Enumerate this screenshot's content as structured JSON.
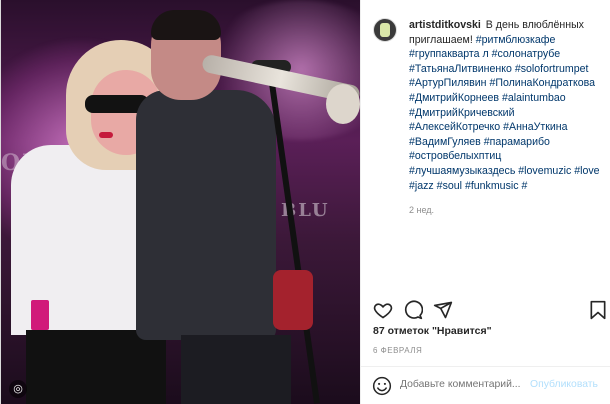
{
  "post": {
    "username": "artistditkovski",
    "caption_text": "В день влюблённых приглашаем!",
    "hashtags": "#ритмблюзкафе #группакварта л #солонатрубе #ТатьянаЛитвиненко #solofortrumpet #АртурПилявин #ПолинаКондраткова #ДмитрийКорнеев #alaintumbao #ДмитрийКричевский #АлексейКотречко #АннаУткина #ВадимГуляев #парамарибо #островбелыхптиц #лучшаямузыказдесь #lovemuzic #love #jazz #soul #funkmusic #",
    "time_ago": "2 нед.",
    "likes": "87 отметок \"Нравится\"",
    "date": "6 ФЕВРАЛЯ"
  },
  "comment_box": {
    "placeholder": "Добавьте комментарий...",
    "publish_label": "Опубликовать"
  },
  "icons": {
    "heart": "heart-icon",
    "comment": "comment-icon",
    "share": "share-icon",
    "save": "bookmark-icon",
    "emoji": "smile-icon",
    "photo_badge": "instagram-icon"
  },
  "colors": {
    "link": "#00376b",
    "muted": "#8e8e8e",
    "publish_disabled": "#b2dffc"
  }
}
